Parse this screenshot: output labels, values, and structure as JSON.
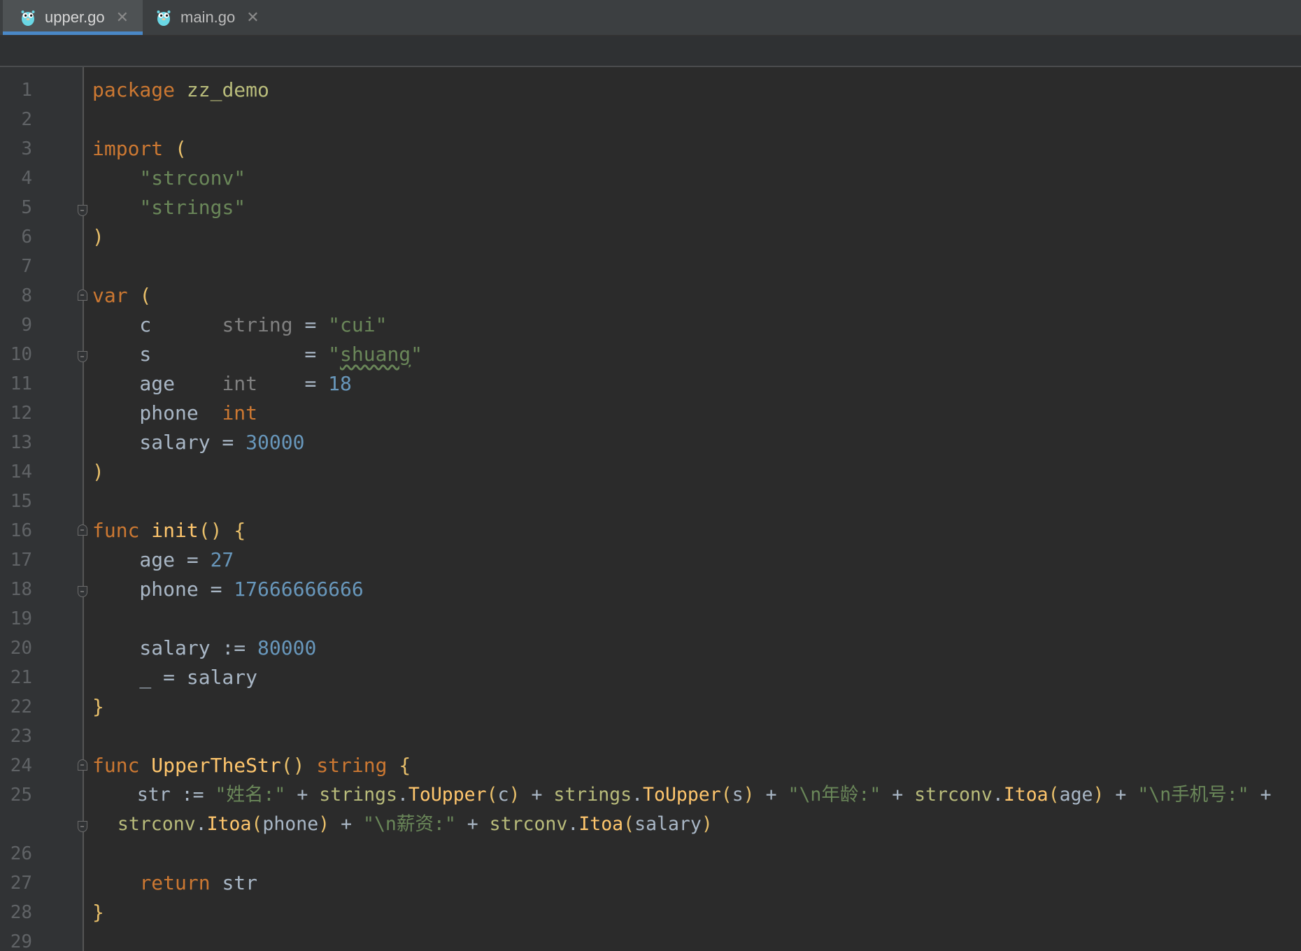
{
  "tabs": [
    {
      "label": "upper.go",
      "active": true,
      "icon": "gopher-icon"
    },
    {
      "label": "main.go",
      "active": false,
      "icon": "gopher-icon"
    }
  ],
  "code_lines": [
    {
      "n": "1"
    },
    {
      "n": "2"
    },
    {
      "n": "3"
    },
    {
      "n": "4"
    },
    {
      "n": "5"
    },
    {
      "n": "6"
    },
    {
      "n": "7"
    },
    {
      "n": "8"
    },
    {
      "n": "9"
    },
    {
      "n": "10"
    },
    {
      "n": "11"
    },
    {
      "n": "12"
    },
    {
      "n": "13"
    },
    {
      "n": "14"
    },
    {
      "n": "15"
    },
    {
      "n": "16"
    },
    {
      "n": "17"
    },
    {
      "n": "18"
    },
    {
      "n": "19"
    },
    {
      "n": "20"
    },
    {
      "n": "21"
    },
    {
      "n": "22"
    },
    {
      "n": "23"
    },
    {
      "n": "24"
    },
    {
      "n": "25"
    },
    {
      "n": "26"
    },
    {
      "n": "27"
    },
    {
      "n": "28"
    },
    {
      "n": "29"
    }
  ],
  "code": {
    "l1": [
      "package",
      " ",
      "zz_demo"
    ],
    "l3": [
      "import",
      " ",
      "("
    ],
    "l4": [
      "    ",
      "\"strconv\""
    ],
    "l5": [
      "    ",
      "\"strings\""
    ],
    "l6": [
      ")"
    ],
    "l8": [
      "var",
      " ",
      "("
    ],
    "l9": [
      "    c      ",
      "string",
      " = ",
      "\"cui\""
    ],
    "l10": [
      "    s             = ",
      "\"",
      "shuang",
      "\""
    ],
    "l11": [
      "    age    ",
      "int",
      "    = ",
      "18"
    ],
    "l12": [
      "    phone  ",
      "int"
    ],
    "l13": [
      "    salary = ",
      "30000"
    ],
    "l14": [
      ")"
    ],
    "l16": [
      "func",
      " ",
      "init",
      "()",
      " ",
      "{"
    ],
    "l17": [
      "    age = ",
      "27"
    ],
    "l18": [
      "    phone = ",
      "17666666666"
    ],
    "l20": [
      "    salary := ",
      "80000"
    ],
    "l21": [
      "    _ = salary"
    ],
    "l22": [
      "}"
    ],
    "l24": [
      "func",
      " ",
      "UpperTheStr",
      "()",
      " ",
      "string",
      " ",
      "{"
    ],
    "l25a": [
      "    str := ",
      "\"姓名:\"",
      " + ",
      "strings",
      ".",
      "ToUpper",
      "(",
      "c",
      ")",
      " + ",
      "strings",
      ".",
      "ToUpper",
      "(",
      "s",
      ")",
      " + ",
      "\"\\n年龄:\"",
      " + ",
      "strconv",
      ".",
      "Itoa",
      "(",
      "age",
      ")",
      " + ",
      "\"\\n手机号:\"",
      " +"
    ],
    "l25b": [
      "  ",
      "strconv",
      ".",
      "Itoa",
      "(",
      "phone",
      ")",
      " + ",
      "\"\\n薪资:\"",
      " + ",
      "strconv",
      ".",
      "Itoa",
      "(",
      "salary",
      ")"
    ],
    "l27": [
      "    ",
      "return",
      " str"
    ],
    "l28": [
      "}"
    ]
  },
  "colors": {
    "keyword": "#cc7832",
    "string": "#6a8759",
    "number": "#6897bb",
    "function": "#ffc66d",
    "text": "#a9b7c6",
    "tab_underline": "#4a88c7"
  }
}
